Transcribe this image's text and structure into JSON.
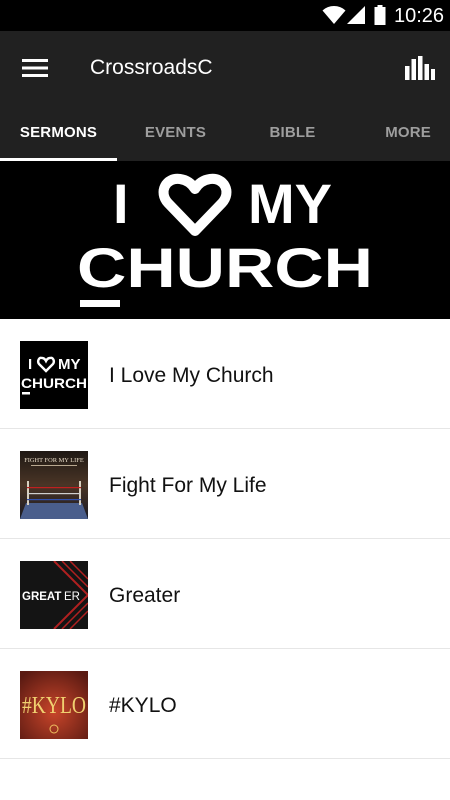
{
  "status_bar": {
    "time": "10:26"
  },
  "app_bar": {
    "title": "CrossroadsC"
  },
  "tabs": [
    {
      "label": "SERMONS",
      "active": true
    },
    {
      "label": "EVENTS",
      "active": false
    },
    {
      "label": "BIBLE",
      "active": false
    },
    {
      "label": "MORE",
      "active": false
    }
  ],
  "banner": {
    "line1": "I",
    "line1b": "MY",
    "line2": "CHURCH"
  },
  "sermons": [
    {
      "title": "I Love My Church",
      "thumb_text_1": "I",
      "thumb_text_1b": "MY",
      "thumb_text_2": "CHURCH"
    },
    {
      "title": "Fight For My Life",
      "thumb_text_1": "FIGHT FOR MY LIFE"
    },
    {
      "title": "Greater",
      "thumb_text_1": "GREAT",
      "thumb_text_1b": "ER"
    },
    {
      "title": "#KYLO",
      "thumb_text_1": "#KYLO"
    }
  ],
  "colors": {
    "app_bar": "#212121",
    "status_bar": "#000000",
    "tab_active": "#ffffff",
    "tab_inactive": "#9e9e9e"
  }
}
